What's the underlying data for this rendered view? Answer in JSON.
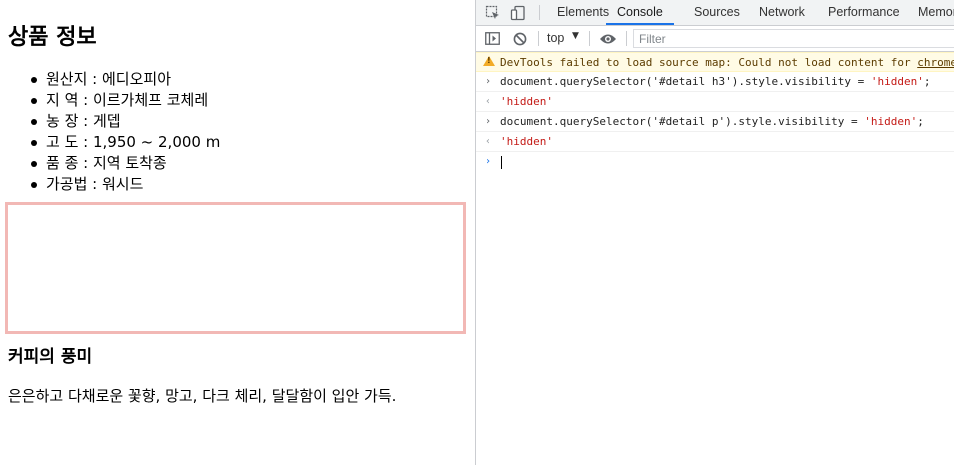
{
  "page": {
    "title": "상품 정보",
    "details": [
      "원산지 : 에디오피아",
      "지 역 : 이르가체프 코체레",
      "농 장 : 게뎁",
      "고 도 : 1,950 ~ 2,000 m",
      "품 종 : 지역 토착종",
      "가공법 : 워시드"
    ],
    "flavor_heading": "커피의 풍미",
    "flavor_text": "은은하고 다채로운 꽃향, 망고, 다크 체리, 달달함이 입안 가득."
  },
  "devtools": {
    "tabs": [
      "Elements",
      "Console",
      "Sources",
      "Network",
      "Performance",
      "Memor"
    ],
    "active_tab": "Console",
    "context": "top",
    "filter_placeholder": "Filter",
    "warning_prefix": "DevTools failed to load source map: Could not load content for ",
    "warning_link": "chrome",
    "console": [
      {
        "kind": "input",
        "code": "document.querySelector('#detail h3').style.visibility = ",
        "string": "'hidden'",
        "end": ";"
      },
      {
        "kind": "result",
        "string": "'hidden'"
      },
      {
        "kind": "input",
        "code": "document.querySelector('#detail p').style.visibility = ",
        "string": "'hidden'",
        "end": ";"
      },
      {
        "kind": "result",
        "string": "'hidden'"
      }
    ]
  },
  "colors": {
    "accent": "#1a73e8",
    "string": "#c41a16",
    "warning_bg": "#fffbe5",
    "box_border": "#f2b8b5"
  }
}
